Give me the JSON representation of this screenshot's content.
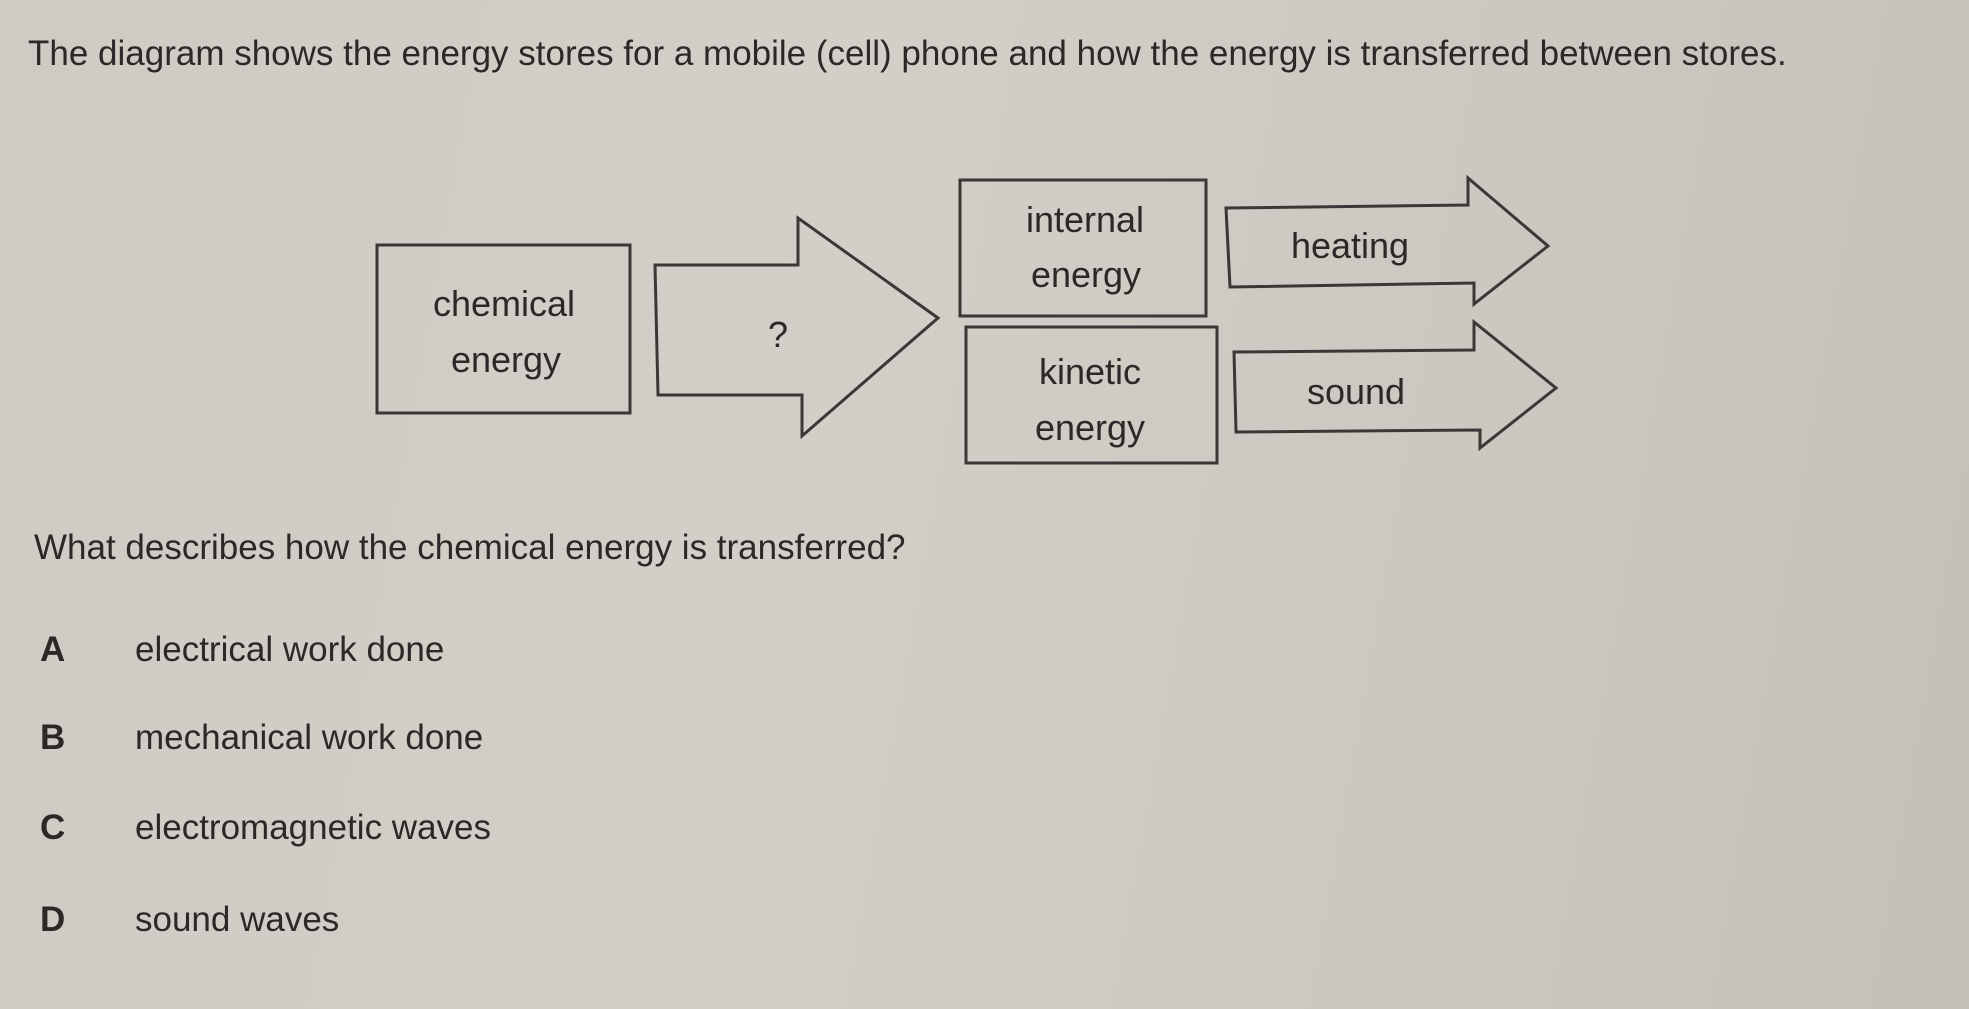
{
  "intro": "The diagram shows the energy stores for a mobile (cell) phone and how the energy is transferred between stores.",
  "diagram": {
    "stores": {
      "chemical": [
        "chemical",
        "energy"
      ],
      "internal": [
        "internal",
        "energy"
      ],
      "kinetic": [
        "kinetic",
        "energy"
      ]
    },
    "transfers": {
      "unknown": "?",
      "heating": "heating",
      "sound": "sound"
    }
  },
  "question": "What describes how the chemical energy is transferred?",
  "options": [
    {
      "letter": "A",
      "text": "electrical work done"
    },
    {
      "letter": "B",
      "text": "mechanical work done"
    },
    {
      "letter": "C",
      "text": "electromagnetic waves"
    },
    {
      "letter": "D",
      "text": "sound waves"
    }
  ]
}
